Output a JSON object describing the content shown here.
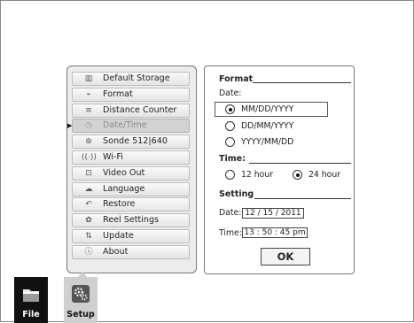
{
  "menu": {
    "items": [
      {
        "label": "Default Storage",
        "icon": "storage-icon"
      },
      {
        "label": "Format",
        "icon": "format-icon"
      },
      {
        "label": "Distance Counter",
        "icon": "distance-counter-icon"
      },
      {
        "label": "Date/Time",
        "icon": "clock-icon",
        "selected": true
      },
      {
        "label": "Sonde 512|640",
        "icon": "sonde-icon"
      },
      {
        "label": "Wi-Fi",
        "icon": "wifi-icon"
      },
      {
        "label": "Video Out",
        "icon": "video-out-icon"
      },
      {
        "label": "Language",
        "icon": "language-icon"
      },
      {
        "label": "Restore",
        "icon": "restore-icon"
      },
      {
        "label": "Reel Settings",
        "icon": "reel-icon"
      },
      {
        "label": "Update",
        "icon": "update-icon"
      },
      {
        "label": "About",
        "icon": "info-icon"
      }
    ]
  },
  "settings": {
    "format_heading": "Format",
    "date_label": "Date:",
    "date_options": [
      {
        "label": "MM/DD/YYYY",
        "selected": true
      },
      {
        "label": "DD/MM/YYYY",
        "selected": false
      },
      {
        "label": "YYYY/MM/DD",
        "selected": false
      }
    ],
    "time_label": "Time:",
    "time_options": [
      {
        "label": "12 hour",
        "selected": false
      },
      {
        "label": "24 hour",
        "selected": true
      }
    ],
    "setting_heading": "Setting",
    "date_field_label": "Date:",
    "date_value": "12 / 15 / 2011",
    "time_field_label": "Time:",
    "time_value": "13 : 50 : 45 pm",
    "ok_label": "OK"
  },
  "tabs": [
    {
      "label": "File",
      "icon": "folder-icon",
      "active": false
    },
    {
      "label": "Setup",
      "icon": "gears-icon",
      "active": true
    }
  ]
}
